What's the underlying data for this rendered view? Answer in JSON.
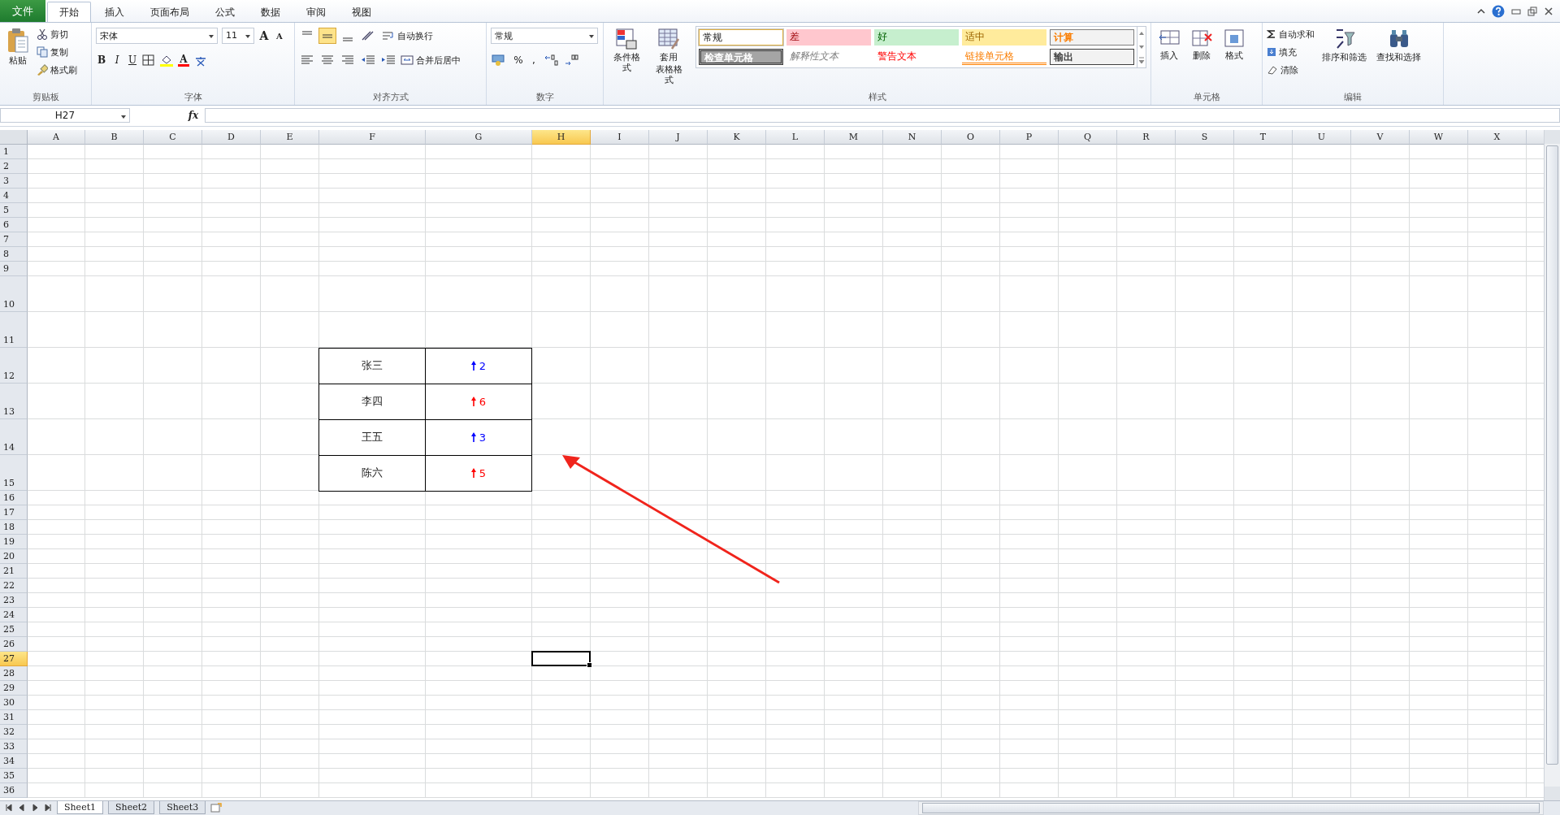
{
  "file_tab": "文件",
  "tabs": [
    {
      "label": "开始",
      "selected": true
    },
    {
      "label": "插入",
      "selected": false
    },
    {
      "label": "页面布局",
      "selected": false
    },
    {
      "label": "公式",
      "selected": false
    },
    {
      "label": "数据",
      "selected": false
    },
    {
      "label": "审阅",
      "selected": false
    },
    {
      "label": "视图",
      "selected": false
    }
  ],
  "clipboard": {
    "label": "剪贴板",
    "paste": "粘贴",
    "cut": "剪切",
    "copy": "复制",
    "painter": "格式刷"
  },
  "font": {
    "label": "字体",
    "name": "宋体",
    "size": "11",
    "grow": "A",
    "shrink": "A",
    "bold": "B",
    "italic": "I",
    "underline": "U",
    "color_letter": "A"
  },
  "alignment": {
    "label": "对齐方式",
    "wrap": "自动换行",
    "merge": "合并后居中"
  },
  "number": {
    "label": "数字",
    "format": "常规",
    "percent": "%",
    "comma": ","
  },
  "styles": {
    "label": "样式",
    "conditional": "条件格式",
    "table_format": [
      "套用",
      "表格格式"
    ],
    "cells": [
      {
        "label": "常规",
        "kind": "normal"
      },
      {
        "label": "差",
        "kind": "bad"
      },
      {
        "label": "好",
        "kind": "good"
      },
      {
        "label": "适中",
        "kind": "neutral"
      },
      {
        "label": "计算",
        "kind": "calc"
      },
      {
        "label": "检查单元格",
        "kind": "check"
      },
      {
        "label": "解释性文本",
        "kind": "explanatory"
      },
      {
        "label": "警告文本",
        "kind": "warning"
      },
      {
        "label": "链接单元格",
        "kind": "link"
      },
      {
        "label": "输出",
        "kind": "output"
      }
    ]
  },
  "cells_group": {
    "label": "单元格",
    "insert": "插入",
    "delete": "删除",
    "format": "格式"
  },
  "editing": {
    "label": "编辑",
    "autosum": "自动求和",
    "fill": "填充",
    "clear": "清除",
    "sort": "排序和筛选",
    "find": "查找和选择"
  },
  "name_box": "H27",
  "fx": "fx",
  "sheet": {
    "columns": [
      {
        "label": "A",
        "kind": "narrow",
        "selected": false
      },
      {
        "label": "B",
        "kind": "normal",
        "selected": false
      },
      {
        "label": "C",
        "kind": "normal",
        "selected": false
      },
      {
        "label": "D",
        "kind": "normal",
        "selected": false
      },
      {
        "label": "E",
        "kind": "normal",
        "selected": false
      },
      {
        "label": "F",
        "kind": "wide",
        "selected": false
      },
      {
        "label": "G",
        "kind": "wide",
        "selected": false
      },
      {
        "label": "H",
        "kind": "normal",
        "selected": true
      },
      {
        "label": "I",
        "kind": "normal",
        "selected": false
      },
      {
        "label": "J",
        "kind": "normal",
        "selected": false
      },
      {
        "label": "K",
        "kind": "normal",
        "selected": false
      },
      {
        "label": "L",
        "kind": "normal",
        "selected": false
      },
      {
        "label": "M",
        "kind": "normal",
        "selected": false
      },
      {
        "label": "N",
        "kind": "normal",
        "selected": false
      },
      {
        "label": "O",
        "kind": "normal",
        "selected": false
      },
      {
        "label": "P",
        "kind": "normal",
        "selected": false
      },
      {
        "label": "Q",
        "kind": "normal",
        "selected": false
      },
      {
        "label": "R",
        "kind": "normal",
        "selected": false
      },
      {
        "label": "S",
        "kind": "normal",
        "selected": false
      },
      {
        "label": "T",
        "kind": "normal",
        "selected": false
      },
      {
        "label": "U",
        "kind": "normal",
        "selected": false
      },
      {
        "label": "V",
        "kind": "normal",
        "selected": false
      },
      {
        "label": "W",
        "kind": "normal",
        "selected": false
      },
      {
        "label": "X",
        "kind": "normal",
        "selected": false
      }
    ],
    "rows": [
      {
        "label": "1",
        "kind": "normal",
        "selected": false
      },
      {
        "label": "2",
        "kind": "normal",
        "selected": false
      },
      {
        "label": "3",
        "kind": "normal",
        "selected": false
      },
      {
        "label": "4",
        "kind": "normal",
        "selected": false
      },
      {
        "label": "5",
        "kind": "normal",
        "selected": false
      },
      {
        "label": "6",
        "kind": "normal",
        "selected": false
      },
      {
        "label": "7",
        "kind": "normal",
        "selected": false
      },
      {
        "label": "8",
        "kind": "normal",
        "selected": false
      },
      {
        "label": "9",
        "kind": "normal",
        "selected": false
      },
      {
        "label": "10",
        "kind": "tall",
        "selected": false
      },
      {
        "label": "11",
        "kind": "tall",
        "selected": false
      },
      {
        "label": "12",
        "kind": "tall",
        "selected": false
      },
      {
        "label": "13",
        "kind": "tall",
        "selected": false
      },
      {
        "label": "14",
        "kind": "tall",
        "selected": false
      },
      {
        "label": "15",
        "kind": "tall",
        "selected": false
      },
      {
        "label": "16",
        "kind": "normal",
        "selected": false
      },
      {
        "label": "17",
        "kind": "normal",
        "selected": false
      },
      {
        "label": "18",
        "kind": "normal",
        "selected": false
      },
      {
        "label": "19",
        "kind": "normal",
        "selected": false
      },
      {
        "label": "20",
        "kind": "normal",
        "selected": false
      },
      {
        "label": "21",
        "kind": "normal",
        "selected": false
      },
      {
        "label": "22",
        "kind": "normal",
        "selected": false
      },
      {
        "label": "23",
        "kind": "normal",
        "selected": false
      },
      {
        "label": "24",
        "kind": "normal",
        "selected": false
      },
      {
        "label": "25",
        "kind": "normal",
        "selected": false
      },
      {
        "label": "26",
        "kind": "normal",
        "selected": false
      },
      {
        "label": "27",
        "kind": "normal",
        "selected": true
      },
      {
        "label": "28",
        "kind": "normal",
        "selected": false
      },
      {
        "label": "29",
        "kind": "normal",
        "selected": false
      },
      {
        "label": "30",
        "kind": "normal",
        "selected": false
      },
      {
        "label": "31",
        "kind": "normal",
        "selected": false
      },
      {
        "label": "32",
        "kind": "normal",
        "selected": false
      },
      {
        "label": "33",
        "kind": "normal",
        "selected": false
      },
      {
        "label": "34",
        "kind": "normal",
        "selected": false
      },
      {
        "label": "35",
        "kind": "normal",
        "selected": false
      },
      {
        "label": "36",
        "kind": "normal",
        "selected": false
      }
    ],
    "table": [
      {
        "name": "张三",
        "value": "2",
        "color": "#0000ff"
      },
      {
        "name": "李四",
        "value": "6",
        "color": "#ff0000"
      },
      {
        "name": "王五",
        "value": "3",
        "color": "#0000ff"
      },
      {
        "name": "陈六",
        "value": "5",
        "color": "#ff0000"
      }
    ]
  },
  "sheets": [
    {
      "label": "Sheet1",
      "selected": true
    },
    {
      "label": "Sheet2",
      "selected": false
    },
    {
      "label": "Sheet3",
      "selected": false
    }
  ]
}
